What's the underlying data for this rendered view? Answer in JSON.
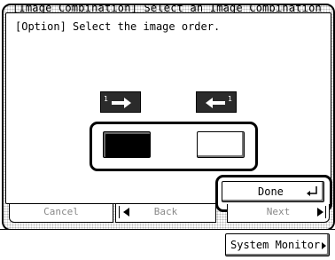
{
  "background_title": "[Image Combination] Select an Image Combination",
  "dialog": {
    "title": "[Option] Select the image order.",
    "order_icons": [
      {
        "name": "left-to-right-order-icon",
        "number": "1"
      },
      {
        "name": "right-to-left-order-icon",
        "number": "1"
      }
    ],
    "options": [
      {
        "name": "left-to-right",
        "selected": true
      },
      {
        "name": "right-to-left",
        "selected": false
      }
    ],
    "done_label": "Done"
  },
  "nav": {
    "cancel_label": "Cancel",
    "back_label": "Back",
    "next_label": "Next"
  },
  "status": {
    "system_monitor_label": "System Monitor"
  }
}
